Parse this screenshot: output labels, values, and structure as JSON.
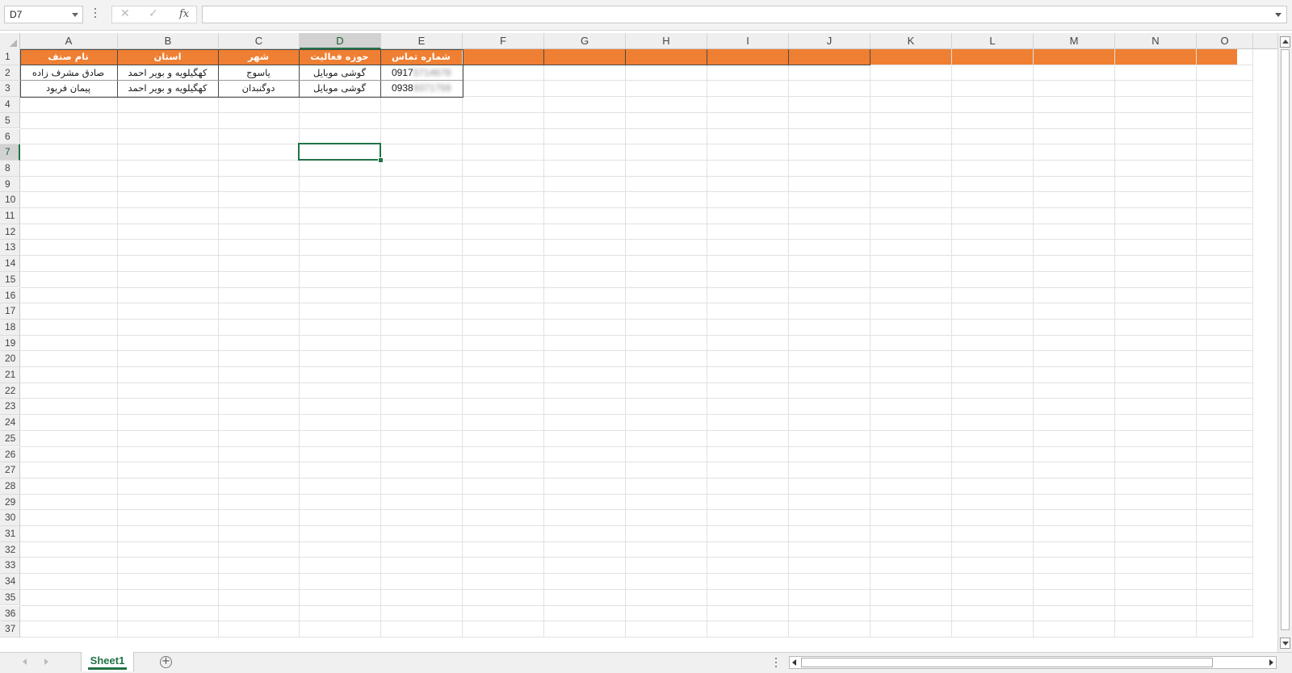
{
  "formula_bar": {
    "name_box": "D7",
    "cancel_icon": "✕",
    "enter_icon": "✓",
    "fx_label": "fx",
    "formula_value": ""
  },
  "grid": {
    "columns": [
      "A",
      "B",
      "C",
      "D",
      "E",
      "F",
      "G",
      "H",
      "I",
      "J",
      "K",
      "L",
      "M",
      "N",
      "O"
    ],
    "selected_column": "D",
    "rows": [
      "1",
      "2",
      "3",
      "4",
      "5",
      "6",
      "7",
      "8",
      "9",
      "10",
      "11",
      "12",
      "13",
      "14",
      "15",
      "16",
      "17",
      "18",
      "19",
      "20",
      "21",
      "22",
      "23",
      "24",
      "25",
      "26",
      "27",
      "28",
      "29",
      "30",
      "31",
      "32",
      "33",
      "34",
      "35",
      "36",
      "37"
    ],
    "selected_row": "7",
    "selected_cell": "D7",
    "header_fill_color": "#ef7f32",
    "table": {
      "headers": [
        "نام صنف",
        "استان",
        "شهر",
        "حوزه فعالیت",
        "شماره تماس"
      ],
      "rows": [
        {
          "name": "صادق مشرف زاده",
          "province": "کهگیلویه و بویر احمد",
          "city": "یاسوج",
          "field": "گوشی موبایل",
          "phone_visible": "0917",
          "phone_blurred": "5714678"
        },
        {
          "name": "پیمان فربود",
          "province": "کهگیلویه و بویر احمد",
          "city": "دوگنبدان",
          "field": "گوشی موبایل",
          "phone_visible": "0938",
          "phone_blurred": "9371759"
        }
      ]
    }
  },
  "sheet_tabs": {
    "active": "Sheet1",
    "add_label": "+"
  },
  "colors": {
    "accent_green": "#217346",
    "header_orange": "#ef7f32"
  }
}
